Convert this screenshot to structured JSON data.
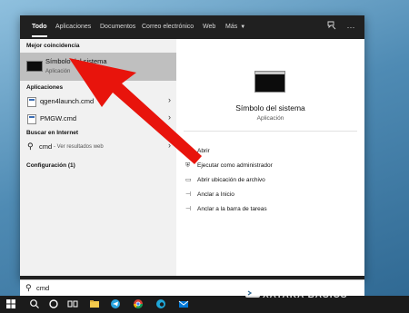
{
  "tabs": [
    {
      "label": "Todo"
    },
    {
      "label": "Aplicaciones"
    },
    {
      "label": "Documentos"
    },
    {
      "label": "Correo electrónico"
    },
    {
      "label": "Web"
    },
    {
      "label": "Más"
    }
  ],
  "toolbar": {
    "feedback_icon": "feedback-icon",
    "more_icon": "ellipsis-icon",
    "more_label": "···"
  },
  "left": {
    "best_match_heading": "Mejor coincidencia",
    "best_match": {
      "title": "Símbolo del sistema",
      "subtitle": "Aplicación"
    },
    "apps_heading": "Aplicaciones",
    "apps": [
      {
        "name": "qgen4launch.cmd"
      },
      {
        "name": "PMGW.cmd"
      }
    ],
    "web_heading": "Buscar en Internet",
    "web_result": {
      "query": "cmd",
      "suffix": "- Ver resultados web"
    },
    "config_heading": "Configuración (1)"
  },
  "right": {
    "title": "Símbolo del sistema",
    "subtitle": "Aplicación",
    "actions": [
      {
        "label": "Abrir",
        "icon": "open-icon",
        "glyph": "↗"
      },
      {
        "label": "Ejecutar como administrador",
        "icon": "shield-icon",
        "glyph": "⛨"
      },
      {
        "label": "Abrir ubicación de archivo",
        "icon": "folder-icon",
        "glyph": "▭"
      },
      {
        "label": "Anclar a Inicio",
        "icon": "pin-icon",
        "glyph": "⊣"
      },
      {
        "label": "Anclar a la barra de tareas",
        "icon": "pin-icon",
        "glyph": "⊣"
      }
    ]
  },
  "search": {
    "value": "cmd"
  },
  "watermark": "XATAKA BASICS",
  "colors": {
    "accent": "#0078d7",
    "arrow": "#e8140c",
    "panel": "#202020"
  }
}
